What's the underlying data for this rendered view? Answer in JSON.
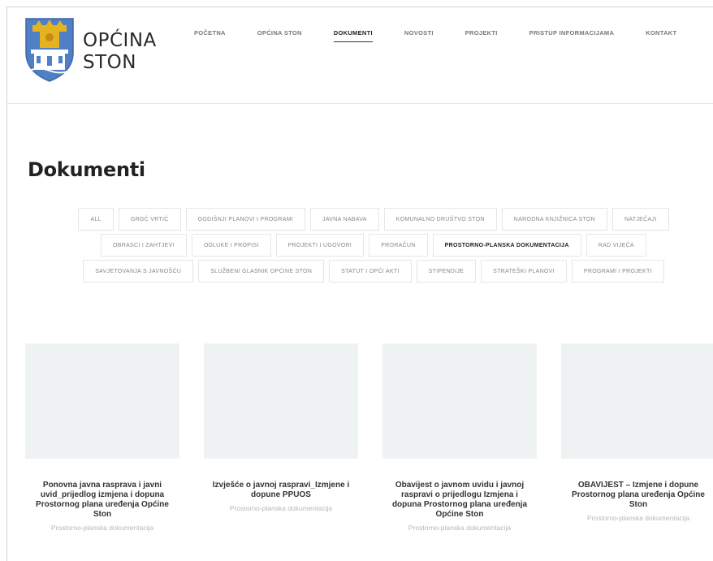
{
  "brand": {
    "line1": "OPĆINA",
    "line2": "STON"
  },
  "nav": [
    {
      "label": "POČETNA",
      "active": false
    },
    {
      "label": "OPĆINA STON",
      "active": false
    },
    {
      "label": "DOKUMENTI",
      "active": true
    },
    {
      "label": "NOVOSTI",
      "active": false
    },
    {
      "label": "PROJEKTI",
      "active": false
    },
    {
      "label": "PRISTUP INFORMACIJAMA",
      "active": false
    },
    {
      "label": "KONTAKT",
      "active": false
    }
  ],
  "page_title": "Dokumenti",
  "filters": [
    {
      "label": "ALL",
      "active": false
    },
    {
      "label": "GRGĆ VRTIĆ",
      "active": false
    },
    {
      "label": "GODIŠNJI PLANOVI I PROGRAMI",
      "active": false
    },
    {
      "label": "JAVNA NABAVA",
      "active": false
    },
    {
      "label": "KOMUNALNO DRUŠTVO STON",
      "active": false
    },
    {
      "label": "NARODNA KNJIŽNICA STON",
      "active": false
    },
    {
      "label": "NATJEČAJI",
      "active": false
    },
    {
      "label": "OBRASCI I ZAHTJEVI",
      "active": false
    },
    {
      "label": "ODLUKE I PROPISI",
      "active": false
    },
    {
      "label": "PROJEKTI I UGOVORI",
      "active": false
    },
    {
      "label": "PRORAČUN",
      "active": false
    },
    {
      "label": "PROSTORNO-PLANSKA DOKUMENTACIJA",
      "active": true
    },
    {
      "label": "RAD VIJEĆA",
      "active": false
    },
    {
      "label": "SAVJETOVANJA S JAVNOŠĆU",
      "active": false
    },
    {
      "label": "SLUŽBENI GLASNIK OPĆINE STON",
      "active": false
    },
    {
      "label": "STATUT I OPĆI AKTI",
      "active": false
    },
    {
      "label": "STIPENDIJE",
      "active": false
    },
    {
      "label": "STRATEŠKI PLANOVI",
      "active": false
    },
    {
      "label": "PROGRAMI I PROJEKTI",
      "active": false
    }
  ],
  "cards": [
    {
      "title": "Ponovna javna rasprava i javni uvid_prijedlog izmjena i dopuna Prostornog plana uređenja Općine Ston",
      "category": "Prostorno-planska dokumentacija"
    },
    {
      "title": "Izvješće o javnoj raspravi_Izmjene i dopune PPUOS",
      "category": "Prostorno-planska dokumentacija"
    },
    {
      "title": "Obavijest o javnom uvidu i javnoj raspravi o prijedlogu Izmjena i dopuna Prostornog plana uređenja Općine Ston",
      "category": "Prostorno-planska dokumentacija"
    },
    {
      "title": "OBAVIJEST – Izmjene i dopune Prostornog plana uređenja Općine Ston",
      "category": "Prostorno-planska dokumentacija"
    }
  ],
  "colors": {
    "crest_blue": "#4f7fc4",
    "crest_gold": "#e3b420",
    "card_placeholder": "#eff2f3"
  }
}
